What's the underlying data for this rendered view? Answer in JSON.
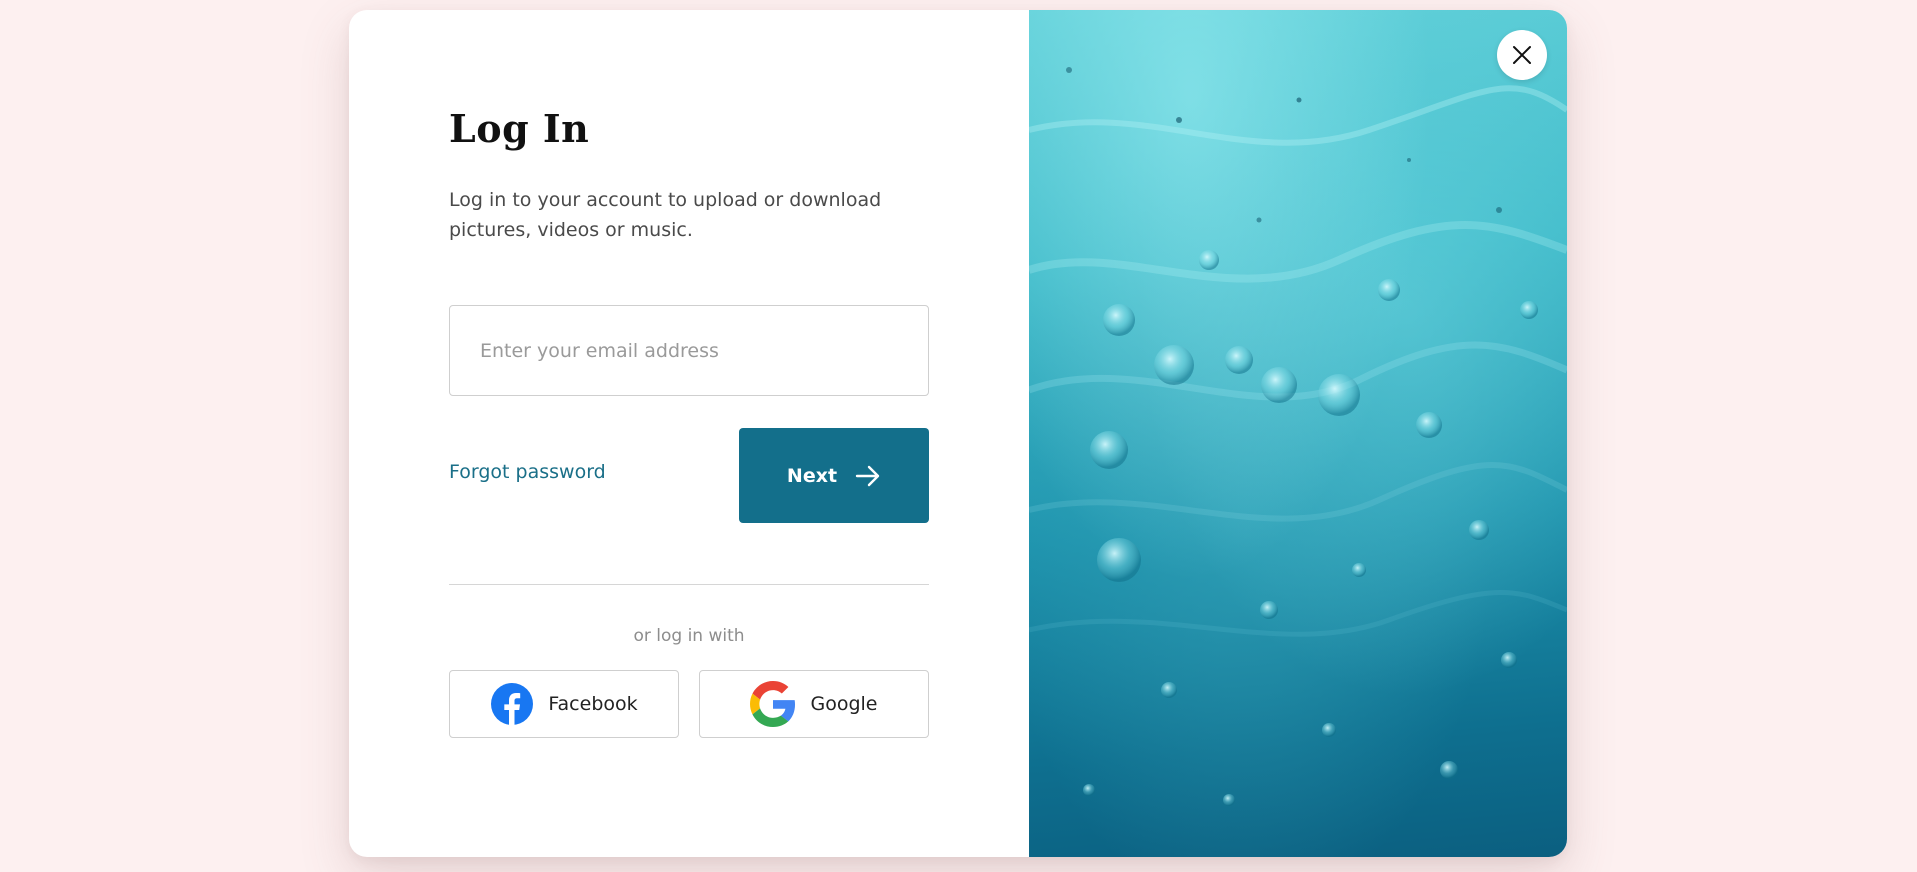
{
  "login": {
    "title": "Log In",
    "subtitle": "Log in to your account to upload or download pictures, videos or music.",
    "email_placeholder": "Enter your email address",
    "email_value": "",
    "forgot_password": "Forgot password",
    "next_label": "Next",
    "or_text": "or log in with",
    "facebook_label": "Facebook",
    "google_label": "Google"
  },
  "icons": {
    "close": "close-icon",
    "next": "arrow-right-icon",
    "facebook": "facebook-icon",
    "google": "google-icon"
  },
  "colors": {
    "page_background": "#fdf0f0",
    "accent": "#136f8b",
    "link": "#1a6f88",
    "facebook_blue": "#1877f2"
  }
}
